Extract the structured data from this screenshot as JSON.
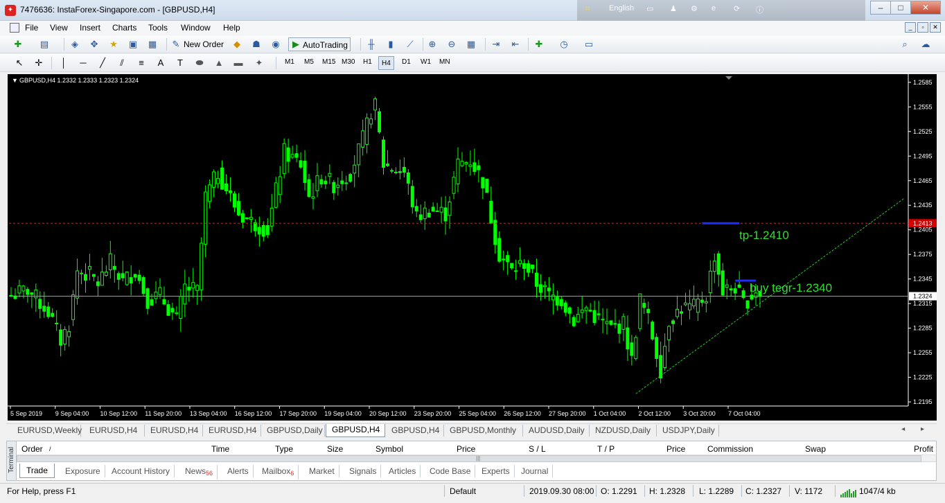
{
  "window": {
    "title": "7476636: InstaForex-Singapore.com - [GBPUSD,H4]",
    "language": "English",
    "min_label": "–",
    "max_label": "□",
    "close_label": "✕"
  },
  "menu": [
    "File",
    "View",
    "Insert",
    "Charts",
    "Tools",
    "Window",
    "Help"
  ],
  "mdi": [
    "_",
    "▫",
    "✕"
  ],
  "toolbar": {
    "new_order": "New Order",
    "autotrading": "AutoTrading"
  },
  "timeframes": [
    "M1",
    "M5",
    "M15",
    "M30",
    "H1",
    "H4",
    "D1",
    "W1",
    "MN"
  ],
  "active_timeframe": "H4",
  "chart": {
    "header": "GBPUSD,H4  1.2332 1.2333 1.2323 1.2324",
    "header_arrow": "▼",
    "annotation_tp": "tp-1.2410",
    "annotation_buy": "buy tegr-1.2340",
    "current_price_label": "1.2324",
    "red_line_label": "1.2413",
    "colors": {
      "background": "#000000",
      "candle": "#00ff00",
      "text": "#ffffff",
      "annotation": "#33dd33",
      "red_line": "#d02020",
      "blue_line": "#1e2cff",
      "trendline": "#22cc22",
      "price_box": "#ffffff",
      "red_box": "#d40000"
    }
  },
  "chart_data": {
    "type": "candlestick",
    "title": "GBPUSD,H4  1.2332 1.2333 1.2323 1.2324",
    "ylim": [
      1.219,
      1.2595
    ],
    "y_ticks": [
      "1.2585",
      "1.2555",
      "1.2525",
      "1.2495",
      "1.2465",
      "1.2435",
      "1.2405",
      "1.2375",
      "1.2345",
      "1.2315",
      "1.2285",
      "1.2255",
      "1.2225",
      "1.2195"
    ],
    "x_ticks": [
      "5 Sep 2019",
      "9 Sep 04:00",
      "10 Sep 12:00",
      "11 Sep 20:00",
      "13 Sep 04:00",
      "16 Sep 12:00",
      "17 Sep 20:00",
      "19 Sep 04:00",
      "20 Sep 12:00",
      "23 Sep 20:00",
      "25 Sep 04:00",
      "26 Sep 12:00",
      "27 Sep 20:00",
      "1 Oct 04:00",
      "2 Oct 12:00",
      "3 Oct 20:00",
      "7 Oct 04:00"
    ],
    "horizontal_lines": [
      {
        "price": 1.2413,
        "style": "dashed",
        "color": "red"
      },
      {
        "price": 1.2324,
        "style": "solid",
        "color": "gray"
      }
    ],
    "blue_levels": [
      {
        "price": 1.2413,
        "from_bar": 167,
        "to_bar": 176
      },
      {
        "price": 1.2343,
        "from_bar": 175,
        "to_bar": 180
      }
    ],
    "trendline": {
      "from": {
        "bar": 151,
        "price": 1.2205
      },
      "to": {
        "bar": 216,
        "price": 1.2444
      }
    },
    "anchors": [
      {
        "bar": 0,
        "price": 1.2325
      },
      {
        "bar": 4,
        "price": 1.2332
      },
      {
        "bar": 9,
        "price": 1.2305
      },
      {
        "bar": 12,
        "price": 1.227
      },
      {
        "bar": 14,
        "price": 1.229
      },
      {
        "bar": 16,
        "price": 1.2355
      },
      {
        "bar": 19,
        "price": 1.235
      },
      {
        "bar": 21,
        "price": 1.234
      },
      {
        "bar": 24,
        "price": 1.2365
      },
      {
        "bar": 27,
        "price": 1.2342
      },
      {
        "bar": 30,
        "price": 1.2355
      },
      {
        "bar": 33,
        "price": 1.232
      },
      {
        "bar": 36,
        "price": 1.2325
      },
      {
        "bar": 40,
        "price": 1.2295
      },
      {
        "bar": 42,
        "price": 1.2335
      },
      {
        "bar": 45,
        "price": 1.233
      },
      {
        "bar": 47,
        "price": 1.2445
      },
      {
        "bar": 50,
        "price": 1.2475
      },
      {
        "bar": 52,
        "price": 1.2455
      },
      {
        "bar": 55,
        "price": 1.2425
      },
      {
        "bar": 58,
        "price": 1.2415
      },
      {
        "bar": 62,
        "price": 1.2405
      },
      {
        "bar": 66,
        "price": 1.25
      },
      {
        "bar": 70,
        "price": 1.2485
      },
      {
        "bar": 72,
        "price": 1.2445
      },
      {
        "bar": 75,
        "price": 1.247
      },
      {
        "bar": 78,
        "price": 1.246
      },
      {
        "bar": 82,
        "price": 1.2475
      },
      {
        "bar": 85,
        "price": 1.2515
      },
      {
        "bar": 87,
        "price": 1.255
      },
      {
        "bar": 88,
        "price": 1.2555
      },
      {
        "bar": 90,
        "price": 1.2485
      },
      {
        "bar": 92,
        "price": 1.248
      },
      {
        "bar": 95,
        "price": 1.2475
      },
      {
        "bar": 98,
        "price": 1.242
      },
      {
        "bar": 101,
        "price": 1.243
      },
      {
        "bar": 105,
        "price": 1.2425
      },
      {
        "bar": 108,
        "price": 1.2485
      },
      {
        "bar": 111,
        "price": 1.249
      },
      {
        "bar": 114,
        "price": 1.2465
      },
      {
        "bar": 116,
        "price": 1.242
      },
      {
        "bar": 118,
        "price": 1.2375
      },
      {
        "bar": 121,
        "price": 1.2355
      },
      {
        "bar": 124,
        "price": 1.2365
      },
      {
        "bar": 127,
        "price": 1.234
      },
      {
        "bar": 130,
        "price": 1.2325
      },
      {
        "bar": 133,
        "price": 1.232
      },
      {
        "bar": 136,
        "price": 1.2295
      },
      {
        "bar": 139,
        "price": 1.231
      },
      {
        "bar": 142,
        "price": 1.2295
      },
      {
        "bar": 145,
        "price": 1.2285
      },
      {
        "bar": 148,
        "price": 1.229
      },
      {
        "bar": 150,
        "price": 1.2245
      },
      {
        "bar": 152,
        "price": 1.232
      },
      {
        "bar": 154,
        "price": 1.2295
      },
      {
        "bar": 157,
        "price": 1.2235
      },
      {
        "bar": 159,
        "price": 1.2295
      },
      {
        "bar": 162,
        "price": 1.231
      },
      {
        "bar": 165,
        "price": 1.231
      },
      {
        "bar": 168,
        "price": 1.2325
      },
      {
        "bar": 170,
        "price": 1.2375
      },
      {
        "bar": 172,
        "price": 1.233
      },
      {
        "bar": 175,
        "price": 1.2335
      },
      {
        "bar": 177,
        "price": 1.2315
      },
      {
        "bar": 179,
        "price": 1.2325
      },
      {
        "bar": 180,
        "price": 1.2332
      },
      {
        "bar": 181,
        "price": 1.2324
      }
    ]
  },
  "chart_tabs": [
    "EURUSD,Weekly",
    "EURUSD,H4",
    "EURUSD,H4",
    "EURUSD,H4",
    "GBPUSD,Daily",
    "GBPUSD,H4",
    "GBPUSD,H4",
    "GBPUSD,Monthly",
    "AUDUSD,Daily",
    "NZDUSD,Daily",
    "USDJPY,Daily"
  ],
  "chart_tab_arrows": "◂ ▸",
  "terminal": {
    "side_label": "Terminal",
    "columns": [
      "Order",
      "/",
      "Time",
      "Type",
      "Size",
      "Symbol",
      "Price",
      "S / L",
      "T / P",
      "Price",
      "Commission",
      "Swap",
      "Profit"
    ],
    "grip": "|||",
    "tabs": [
      "Trade",
      "Exposure",
      "Account History",
      "News",
      "Alerts",
      "Mailbox",
      "Market",
      "Signals",
      "Articles",
      "Code Base",
      "Experts",
      "Journal"
    ],
    "news_count": "56",
    "mailbox_count": "6"
  },
  "status": {
    "help": "For Help, press F1",
    "profile": "Default",
    "datetime": "2019.09.30 08:00",
    "open": "O: 1.2291",
    "high": "H: 1.2328",
    "low": "L: 1.2289",
    "close": "C: 1.2327",
    "volume": "V: 1172",
    "traffic": "1047/4 kb"
  }
}
